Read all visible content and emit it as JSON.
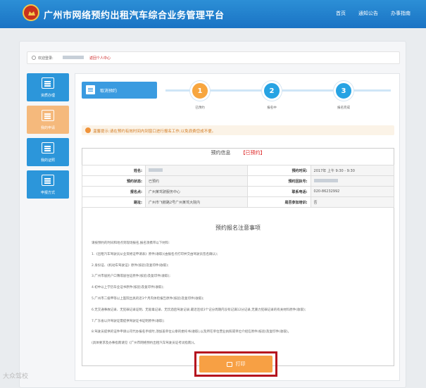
{
  "header": {
    "title": "广州市网络预约出租汽车综合业务管理平台",
    "nav": [
      "首页",
      "通知公告",
      "办事指南"
    ]
  },
  "welcome": {
    "label": "欢迎登录:",
    "center": "返回个人中心"
  },
  "sidebar": {
    "items": [
      {
        "label": "资质办理"
      },
      {
        "label": "我的申请"
      },
      {
        "label": "我的证照"
      },
      {
        "label": "申报方式"
      }
    ]
  },
  "tabs": {
    "cancel": "取消预约"
  },
  "steps": [
    {
      "number": "1",
      "label": "已预约"
    },
    {
      "number": "2",
      "label": "报名中"
    },
    {
      "number": "3",
      "label": "报名完成"
    }
  ],
  "tip": "温馨提示:请在预约有效时间内到窗口进行报名工作,以免浪费您成不便。",
  "info": {
    "title": "预约信息",
    "status": "【已预约】",
    "rows": [
      {
        "k1": "姓名:",
        "v1": "",
        "k2": "预约时间:",
        "v2": "2017年 上午 9:30 - 9:30"
      },
      {
        "k1": "预约状态:",
        "v1": "已预约",
        "k2": "预约回执号:",
        "v2": ""
      },
      {
        "k1": "报名点:",
        "v1": "广州某驾驶服务中心",
        "k2": "联系电话:",
        "v2": "020-86232992"
      },
      {
        "k1": "路址:",
        "v1": "广州市飞鹅路2号广州某驾大院内",
        "k2": "是否参加培训:",
        "v2": "否"
      }
    ]
  },
  "notes": {
    "title": "预约报名注意事项",
    "lines": [
      "请按预约的时间和地点到现场报名,报名须携带以下材料:",
      "1.《出租汽车驾驶员从业资格证申请表》原件(收取)(由报名点打印并交由驾驶员签名确认);",
      "2.身份证、《机动车驾驶证》原件(核验)及复印件(收取);",
      "3.广州市居民户口簿或居住证原件(核验)及复印件(收取);",
      "4.初中以上学历毕业证书原件(核验)及复印件(收取);",
      "5.广州市二级甲等以上医院出具的近3个月内体检报告原件(核验)及复印件(收取);",
      "6.无交通事故记录、无犯罪记录证明、无吸毒记录、无饮酒后驾驶记录,最近连续3个记分周期内没有记满12分记录,无暴力犯罪记录的有关材料原件(收取);",
      "7.广东省以外驾驶证需提供驾驶证书证明原件(收取);",
      "8.驾驶员提供的证件申请公司代办报名手续时,须加盖单位公章的委托书(收取),以及所在单位营业执照或单位介绍信原件(核验)及复印件(收取)。",
      "(具体要求及办事指南请见《广州市网络预约出租汽车驾驶员证考试指南》)。"
    ]
  },
  "print": {
    "label": "打印"
  },
  "watermark": "大众驾校"
}
